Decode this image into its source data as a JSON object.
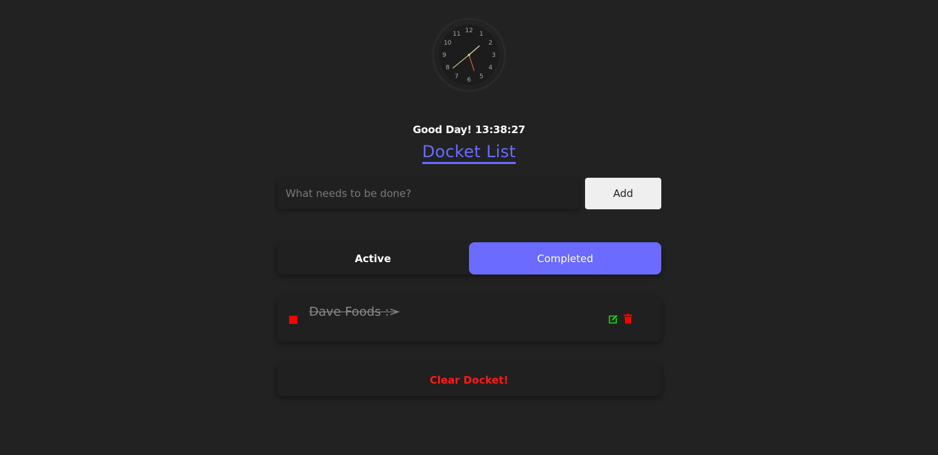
{
  "clock": {
    "numerals": [
      "12",
      "1",
      "2",
      "3",
      "4",
      "5",
      "6",
      "7",
      "8",
      "9",
      "10",
      "11"
    ],
    "time": "13:38:27",
    "colors": {
      "hour_hand": "#e8d9a8",
      "minute_hand": "#e8d9a8",
      "second_hand": "#ff6a4d"
    }
  },
  "header": {
    "greeting": "Good Day! 13:38:27",
    "title": "Docket List"
  },
  "new_task": {
    "placeholder": "What needs to be done?",
    "value": "",
    "add_label": "Add"
  },
  "tabs": [
    {
      "label": "Active",
      "selected": false
    },
    {
      "label": "Completed",
      "selected": true
    }
  ],
  "todos": [
    {
      "text": "Dave Foods :>",
      "completed": true,
      "edit_icon": "edit-icon",
      "delete_icon": "trash-icon"
    }
  ],
  "footer": {
    "clear_label": "Clear Docket!"
  },
  "colors": {
    "accent": "#6b6bff",
    "background": "#222222",
    "danger": "#ff0000",
    "success": "#22dd22"
  }
}
